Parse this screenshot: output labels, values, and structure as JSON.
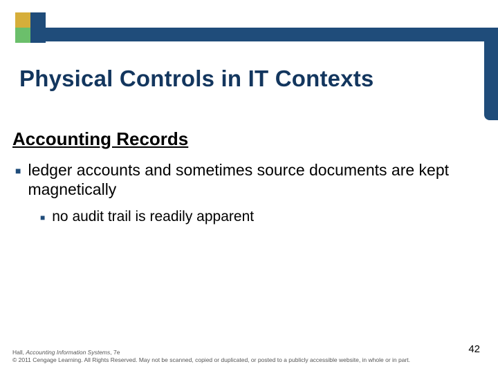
{
  "title": "Physical Controls in IT Contexts",
  "subhead": "Accounting Records",
  "bullets": {
    "lvl1": "ledger accounts and sometimes source documents are kept magnetically",
    "lvl2": "no audit trail is readily apparent"
  },
  "footer": {
    "author": "Hall, ",
    "book": "Accounting Information Systems",
    "edition": ", 7e",
    "copyright": "© 2011 Cengage Learning. All Rights Reserved. May not be scanned, copied or duplicated, or posted to a publicly accessible website, in whole or in part."
  },
  "page_number": "42"
}
